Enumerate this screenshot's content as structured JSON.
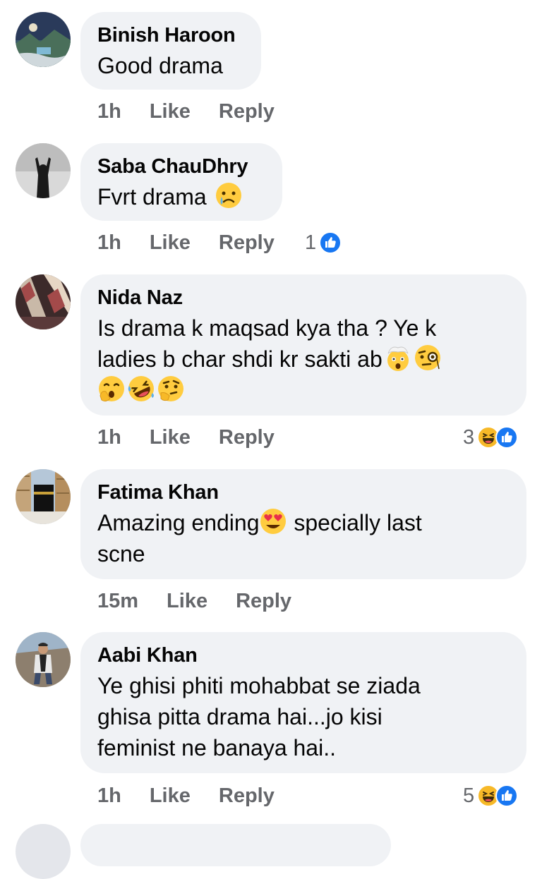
{
  "comments": [
    {
      "name": "Binish Haroon",
      "text": "Good drama",
      "time": "1h",
      "like_label": "Like",
      "reply_label": "Reply",
      "reaction_count": "",
      "avatar": "landscape-photo"
    },
    {
      "name": "Saba ChauDhry",
      "text": "Fvrt drama",
      "emojis": [
        "crying-face"
      ],
      "time": "1h",
      "like_label": "Like",
      "reply_label": "Reply",
      "reaction_count": "1",
      "reactions": [
        "like-icon"
      ],
      "avatar": "silhouette-photo"
    },
    {
      "name": "Nida Naz",
      "text_line1": "Is drama k maqsad kya tha ? Ye k",
      "text_line2": "ladies b char shdi kr sakti ab",
      "emojis_line2": [
        "exploding-head",
        "monocle-face"
      ],
      "emojis_line3": [
        "hand-over-mouth",
        "rolling-laughing",
        "thinking-face"
      ],
      "time": "1h",
      "like_label": "Like",
      "reply_label": "Reply",
      "reaction_count": "3",
      "reactions": [
        "haha-icon",
        "like-icon"
      ],
      "avatar": "decor-photo"
    },
    {
      "name": "Fatima Khan",
      "text_before": "Amazing ending",
      "text_after": " specially last",
      "text_line2": "scne",
      "emojis": [
        "heart-eyes"
      ],
      "time": "15m",
      "like_label": "Like",
      "reply_label": "Reply",
      "reaction_count": "",
      "avatar": "kaaba-photo"
    },
    {
      "name": "Aabi Khan",
      "text_line1": "Ye ghisi phiti mohabbat se ziada",
      "text_line2": "ghisa pitta drama hai...jo kisi",
      "text_line3": "feminist ne banaya hai..",
      "time": "1h",
      "like_label": "Like",
      "reply_label": "Reply",
      "reaction_count": "5",
      "reactions": [
        "haha-icon",
        "like-icon"
      ],
      "avatar": "person-photo"
    }
  ],
  "colors": {
    "bubble": "#f0f2f5",
    "meta_text": "#65676b",
    "like_blue": "#1877f2",
    "haha_yellow": "#f7b928"
  }
}
